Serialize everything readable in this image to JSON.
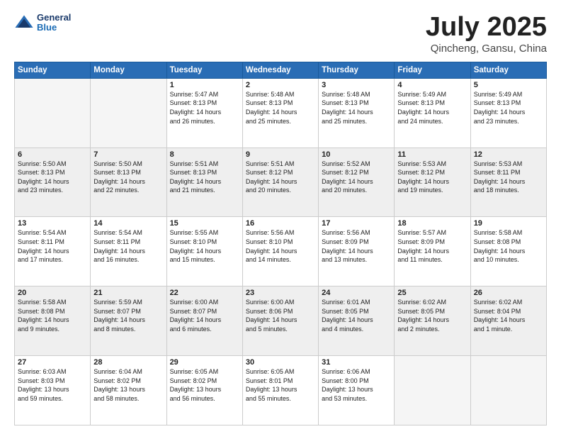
{
  "header": {
    "logo": {
      "general": "General",
      "blue": "Blue"
    },
    "title": "July 2025",
    "location": "Qincheng, Gansu, China"
  },
  "weekdays": [
    "Sunday",
    "Monday",
    "Tuesday",
    "Wednesday",
    "Thursday",
    "Friday",
    "Saturday"
  ],
  "weeks": [
    [
      {
        "day": "",
        "info": ""
      },
      {
        "day": "",
        "info": ""
      },
      {
        "day": "1",
        "info": "Sunrise: 5:47 AM\nSunset: 8:13 PM\nDaylight: 14 hours\nand 26 minutes."
      },
      {
        "day": "2",
        "info": "Sunrise: 5:48 AM\nSunset: 8:13 PM\nDaylight: 14 hours\nand 25 minutes."
      },
      {
        "day": "3",
        "info": "Sunrise: 5:48 AM\nSunset: 8:13 PM\nDaylight: 14 hours\nand 25 minutes."
      },
      {
        "day": "4",
        "info": "Sunrise: 5:49 AM\nSunset: 8:13 PM\nDaylight: 14 hours\nand 24 minutes."
      },
      {
        "day": "5",
        "info": "Sunrise: 5:49 AM\nSunset: 8:13 PM\nDaylight: 14 hours\nand 23 minutes."
      }
    ],
    [
      {
        "day": "6",
        "info": "Sunrise: 5:50 AM\nSunset: 8:13 PM\nDaylight: 14 hours\nand 23 minutes."
      },
      {
        "day": "7",
        "info": "Sunrise: 5:50 AM\nSunset: 8:13 PM\nDaylight: 14 hours\nand 22 minutes."
      },
      {
        "day": "8",
        "info": "Sunrise: 5:51 AM\nSunset: 8:13 PM\nDaylight: 14 hours\nand 21 minutes."
      },
      {
        "day": "9",
        "info": "Sunrise: 5:51 AM\nSunset: 8:12 PM\nDaylight: 14 hours\nand 20 minutes."
      },
      {
        "day": "10",
        "info": "Sunrise: 5:52 AM\nSunset: 8:12 PM\nDaylight: 14 hours\nand 20 minutes."
      },
      {
        "day": "11",
        "info": "Sunrise: 5:53 AM\nSunset: 8:12 PM\nDaylight: 14 hours\nand 19 minutes."
      },
      {
        "day": "12",
        "info": "Sunrise: 5:53 AM\nSunset: 8:11 PM\nDaylight: 14 hours\nand 18 minutes."
      }
    ],
    [
      {
        "day": "13",
        "info": "Sunrise: 5:54 AM\nSunset: 8:11 PM\nDaylight: 14 hours\nand 17 minutes."
      },
      {
        "day": "14",
        "info": "Sunrise: 5:54 AM\nSunset: 8:11 PM\nDaylight: 14 hours\nand 16 minutes."
      },
      {
        "day": "15",
        "info": "Sunrise: 5:55 AM\nSunset: 8:10 PM\nDaylight: 14 hours\nand 15 minutes."
      },
      {
        "day": "16",
        "info": "Sunrise: 5:56 AM\nSunset: 8:10 PM\nDaylight: 14 hours\nand 14 minutes."
      },
      {
        "day": "17",
        "info": "Sunrise: 5:56 AM\nSunset: 8:09 PM\nDaylight: 14 hours\nand 13 minutes."
      },
      {
        "day": "18",
        "info": "Sunrise: 5:57 AM\nSunset: 8:09 PM\nDaylight: 14 hours\nand 11 minutes."
      },
      {
        "day": "19",
        "info": "Sunrise: 5:58 AM\nSunset: 8:08 PM\nDaylight: 14 hours\nand 10 minutes."
      }
    ],
    [
      {
        "day": "20",
        "info": "Sunrise: 5:58 AM\nSunset: 8:08 PM\nDaylight: 14 hours\nand 9 minutes."
      },
      {
        "day": "21",
        "info": "Sunrise: 5:59 AM\nSunset: 8:07 PM\nDaylight: 14 hours\nand 8 minutes."
      },
      {
        "day": "22",
        "info": "Sunrise: 6:00 AM\nSunset: 8:07 PM\nDaylight: 14 hours\nand 6 minutes."
      },
      {
        "day": "23",
        "info": "Sunrise: 6:00 AM\nSunset: 8:06 PM\nDaylight: 14 hours\nand 5 minutes."
      },
      {
        "day": "24",
        "info": "Sunrise: 6:01 AM\nSunset: 8:05 PM\nDaylight: 14 hours\nand 4 minutes."
      },
      {
        "day": "25",
        "info": "Sunrise: 6:02 AM\nSunset: 8:05 PM\nDaylight: 14 hours\nand 2 minutes."
      },
      {
        "day": "26",
        "info": "Sunrise: 6:02 AM\nSunset: 8:04 PM\nDaylight: 14 hours\nand 1 minute."
      }
    ],
    [
      {
        "day": "27",
        "info": "Sunrise: 6:03 AM\nSunset: 8:03 PM\nDaylight: 13 hours\nand 59 minutes."
      },
      {
        "day": "28",
        "info": "Sunrise: 6:04 AM\nSunset: 8:02 PM\nDaylight: 13 hours\nand 58 minutes."
      },
      {
        "day": "29",
        "info": "Sunrise: 6:05 AM\nSunset: 8:02 PM\nDaylight: 13 hours\nand 56 minutes."
      },
      {
        "day": "30",
        "info": "Sunrise: 6:05 AM\nSunset: 8:01 PM\nDaylight: 13 hours\nand 55 minutes."
      },
      {
        "day": "31",
        "info": "Sunrise: 6:06 AM\nSunset: 8:00 PM\nDaylight: 13 hours\nand 53 minutes."
      },
      {
        "day": "",
        "info": ""
      },
      {
        "day": "",
        "info": ""
      }
    ]
  ]
}
